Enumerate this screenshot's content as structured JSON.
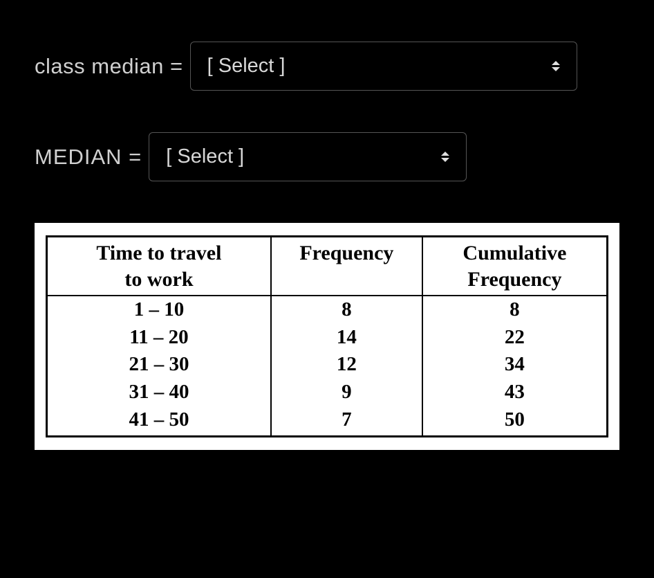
{
  "form": {
    "class_median_label": "class median =",
    "median_label": "MEDIAN =",
    "select_placeholder": "[ Select ]"
  },
  "table": {
    "headers": {
      "col1_line1": "Time to travel",
      "col1_line2": "to work",
      "col2": "Frequency",
      "col3_line1": "Cumulative",
      "col3_line2": "Frequency"
    },
    "rows": [
      {
        "range": "1 – 10",
        "freq": "8",
        "cum": "8"
      },
      {
        "range": "11 – 20",
        "freq": "14",
        "cum": "22"
      },
      {
        "range": "21 – 30",
        "freq": "12",
        "cum": "34"
      },
      {
        "range": "31 – 40",
        "freq": "9",
        "cum": "43"
      },
      {
        "range": "41 – 50",
        "freq": "7",
        "cum": "50"
      }
    ]
  }
}
